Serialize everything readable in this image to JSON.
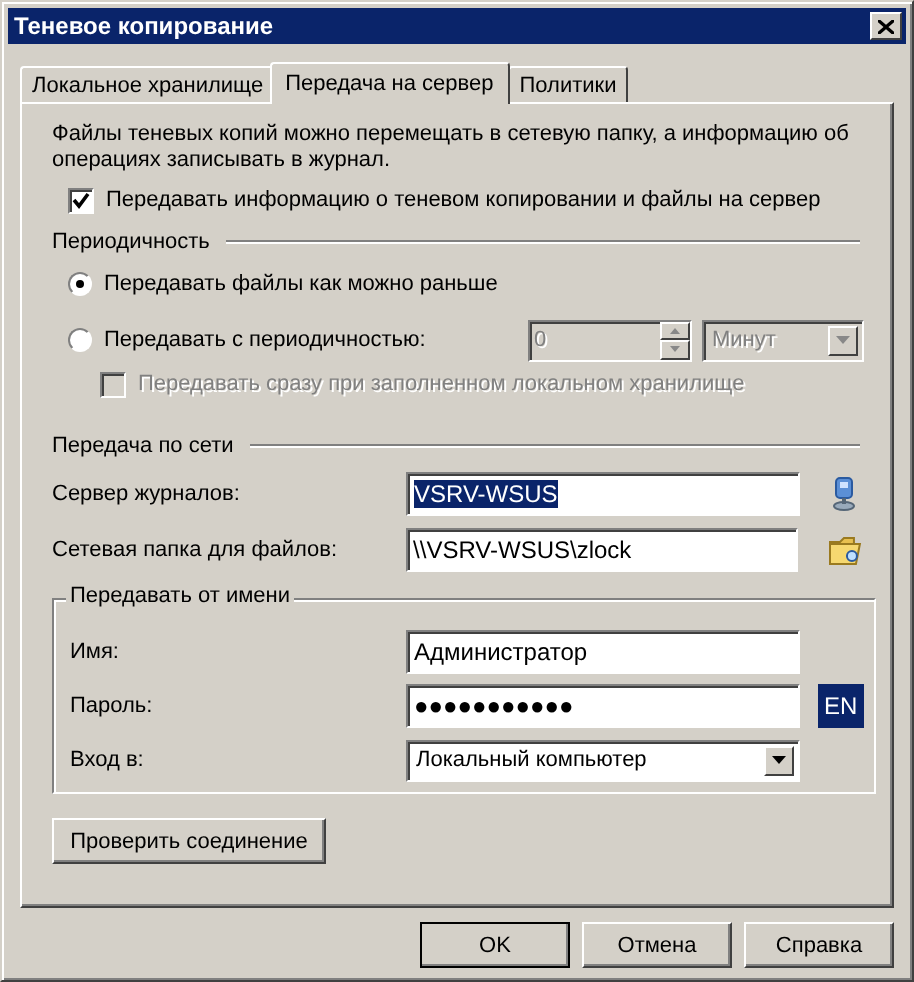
{
  "window": {
    "title": "Теневое копирование"
  },
  "tabs": [
    {
      "label": "Локальное хранилище",
      "selected": false
    },
    {
      "label": "Передача на сервер",
      "selected": true
    },
    {
      "label": "Политики",
      "selected": false
    }
  ],
  "description": "Файлы теневых копий можно перемещать в сетевую папку, а информацию об операциях записывать в журнал.",
  "send_checkbox": {
    "label": "Передавать информацию о теневом копировании и файлы на сервер",
    "checked": true
  },
  "periodicity": {
    "heading": "Периодичность",
    "options": [
      {
        "label": "Передавать файлы как можно раньше",
        "selected": true
      },
      {
        "label": "Передавать с периодичностью:",
        "selected": false
      }
    ],
    "interval": {
      "value": "0",
      "disabled": true
    },
    "unit": {
      "value": "Минут",
      "disabled": true
    },
    "immediate_checkbox": {
      "label": "Передавать сразу при заполненном локальном хранилище",
      "checked": false,
      "disabled": true
    }
  },
  "network": {
    "heading": "Передача по сети",
    "fields": [
      {
        "label": "Сервер журналов:",
        "value": "VSRV-WSUS",
        "highlighted": true,
        "kind": "computer"
      },
      {
        "label": "Сетевая папка для файлов:",
        "value": "\\\\VSRV-WSUS\\zlock",
        "highlighted": false,
        "kind": "folder"
      }
    ]
  },
  "credentials": {
    "title": "Передавать от имени",
    "name": {
      "label": "Имя:",
      "value": "Администратор"
    },
    "password": {
      "label": "Пароль:",
      "value": "●●●●●●●●●●●",
      "layout": "EN"
    },
    "login": {
      "label": "Вход в:",
      "value": "Локальный компьютер"
    }
  },
  "test_button": "Проверить соединение",
  "buttons": [
    {
      "label": "OK",
      "default": true
    },
    {
      "label": "Отмена",
      "default": false
    },
    {
      "label": "Справка",
      "default": false
    }
  ]
}
